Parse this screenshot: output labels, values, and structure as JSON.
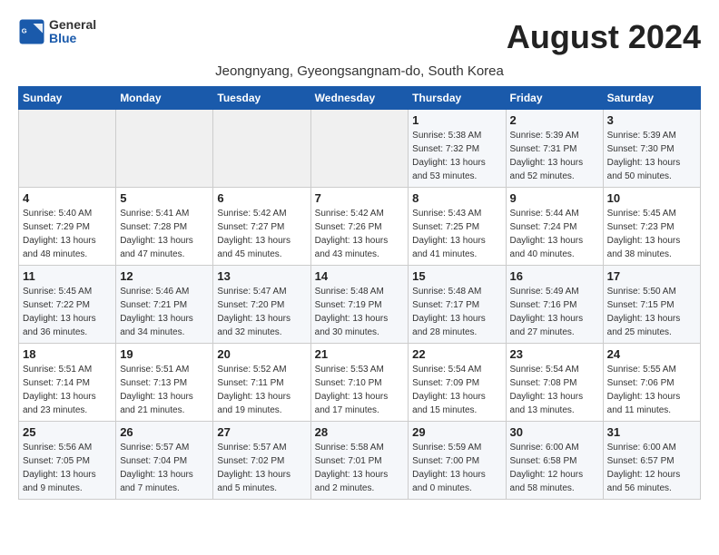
{
  "header": {
    "logo_general": "General",
    "logo_blue": "Blue",
    "month_title": "August 2024",
    "location": "Jeongnyang, Gyeongsangnam-do, South Korea"
  },
  "weekdays": [
    "Sunday",
    "Monday",
    "Tuesday",
    "Wednesday",
    "Thursday",
    "Friday",
    "Saturday"
  ],
  "weeks": [
    [
      {
        "day": "",
        "info": ""
      },
      {
        "day": "",
        "info": ""
      },
      {
        "day": "",
        "info": ""
      },
      {
        "day": "",
        "info": ""
      },
      {
        "day": "1",
        "info": "Sunrise: 5:38 AM\nSunset: 7:32 PM\nDaylight: 13 hours\nand 53 minutes."
      },
      {
        "day": "2",
        "info": "Sunrise: 5:39 AM\nSunset: 7:31 PM\nDaylight: 13 hours\nand 52 minutes."
      },
      {
        "day": "3",
        "info": "Sunrise: 5:39 AM\nSunset: 7:30 PM\nDaylight: 13 hours\nand 50 minutes."
      }
    ],
    [
      {
        "day": "4",
        "info": "Sunrise: 5:40 AM\nSunset: 7:29 PM\nDaylight: 13 hours\nand 48 minutes."
      },
      {
        "day": "5",
        "info": "Sunrise: 5:41 AM\nSunset: 7:28 PM\nDaylight: 13 hours\nand 47 minutes."
      },
      {
        "day": "6",
        "info": "Sunrise: 5:42 AM\nSunset: 7:27 PM\nDaylight: 13 hours\nand 45 minutes."
      },
      {
        "day": "7",
        "info": "Sunrise: 5:42 AM\nSunset: 7:26 PM\nDaylight: 13 hours\nand 43 minutes."
      },
      {
        "day": "8",
        "info": "Sunrise: 5:43 AM\nSunset: 7:25 PM\nDaylight: 13 hours\nand 41 minutes."
      },
      {
        "day": "9",
        "info": "Sunrise: 5:44 AM\nSunset: 7:24 PM\nDaylight: 13 hours\nand 40 minutes."
      },
      {
        "day": "10",
        "info": "Sunrise: 5:45 AM\nSunset: 7:23 PM\nDaylight: 13 hours\nand 38 minutes."
      }
    ],
    [
      {
        "day": "11",
        "info": "Sunrise: 5:45 AM\nSunset: 7:22 PM\nDaylight: 13 hours\nand 36 minutes."
      },
      {
        "day": "12",
        "info": "Sunrise: 5:46 AM\nSunset: 7:21 PM\nDaylight: 13 hours\nand 34 minutes."
      },
      {
        "day": "13",
        "info": "Sunrise: 5:47 AM\nSunset: 7:20 PM\nDaylight: 13 hours\nand 32 minutes."
      },
      {
        "day": "14",
        "info": "Sunrise: 5:48 AM\nSunset: 7:19 PM\nDaylight: 13 hours\nand 30 minutes."
      },
      {
        "day": "15",
        "info": "Sunrise: 5:48 AM\nSunset: 7:17 PM\nDaylight: 13 hours\nand 28 minutes."
      },
      {
        "day": "16",
        "info": "Sunrise: 5:49 AM\nSunset: 7:16 PM\nDaylight: 13 hours\nand 27 minutes."
      },
      {
        "day": "17",
        "info": "Sunrise: 5:50 AM\nSunset: 7:15 PM\nDaylight: 13 hours\nand 25 minutes."
      }
    ],
    [
      {
        "day": "18",
        "info": "Sunrise: 5:51 AM\nSunset: 7:14 PM\nDaylight: 13 hours\nand 23 minutes."
      },
      {
        "day": "19",
        "info": "Sunrise: 5:51 AM\nSunset: 7:13 PM\nDaylight: 13 hours\nand 21 minutes."
      },
      {
        "day": "20",
        "info": "Sunrise: 5:52 AM\nSunset: 7:11 PM\nDaylight: 13 hours\nand 19 minutes."
      },
      {
        "day": "21",
        "info": "Sunrise: 5:53 AM\nSunset: 7:10 PM\nDaylight: 13 hours\nand 17 minutes."
      },
      {
        "day": "22",
        "info": "Sunrise: 5:54 AM\nSunset: 7:09 PM\nDaylight: 13 hours\nand 15 minutes."
      },
      {
        "day": "23",
        "info": "Sunrise: 5:54 AM\nSunset: 7:08 PM\nDaylight: 13 hours\nand 13 minutes."
      },
      {
        "day": "24",
        "info": "Sunrise: 5:55 AM\nSunset: 7:06 PM\nDaylight: 13 hours\nand 11 minutes."
      }
    ],
    [
      {
        "day": "25",
        "info": "Sunrise: 5:56 AM\nSunset: 7:05 PM\nDaylight: 13 hours\nand 9 minutes."
      },
      {
        "day": "26",
        "info": "Sunrise: 5:57 AM\nSunset: 7:04 PM\nDaylight: 13 hours\nand 7 minutes."
      },
      {
        "day": "27",
        "info": "Sunrise: 5:57 AM\nSunset: 7:02 PM\nDaylight: 13 hours\nand 5 minutes."
      },
      {
        "day": "28",
        "info": "Sunrise: 5:58 AM\nSunset: 7:01 PM\nDaylight: 13 hours\nand 2 minutes."
      },
      {
        "day": "29",
        "info": "Sunrise: 5:59 AM\nSunset: 7:00 PM\nDaylight: 13 hours\nand 0 minutes."
      },
      {
        "day": "30",
        "info": "Sunrise: 6:00 AM\nSunset: 6:58 PM\nDaylight: 12 hours\nand 58 minutes."
      },
      {
        "day": "31",
        "info": "Sunrise: 6:00 AM\nSunset: 6:57 PM\nDaylight: 12 hours\nand 56 minutes."
      }
    ]
  ]
}
